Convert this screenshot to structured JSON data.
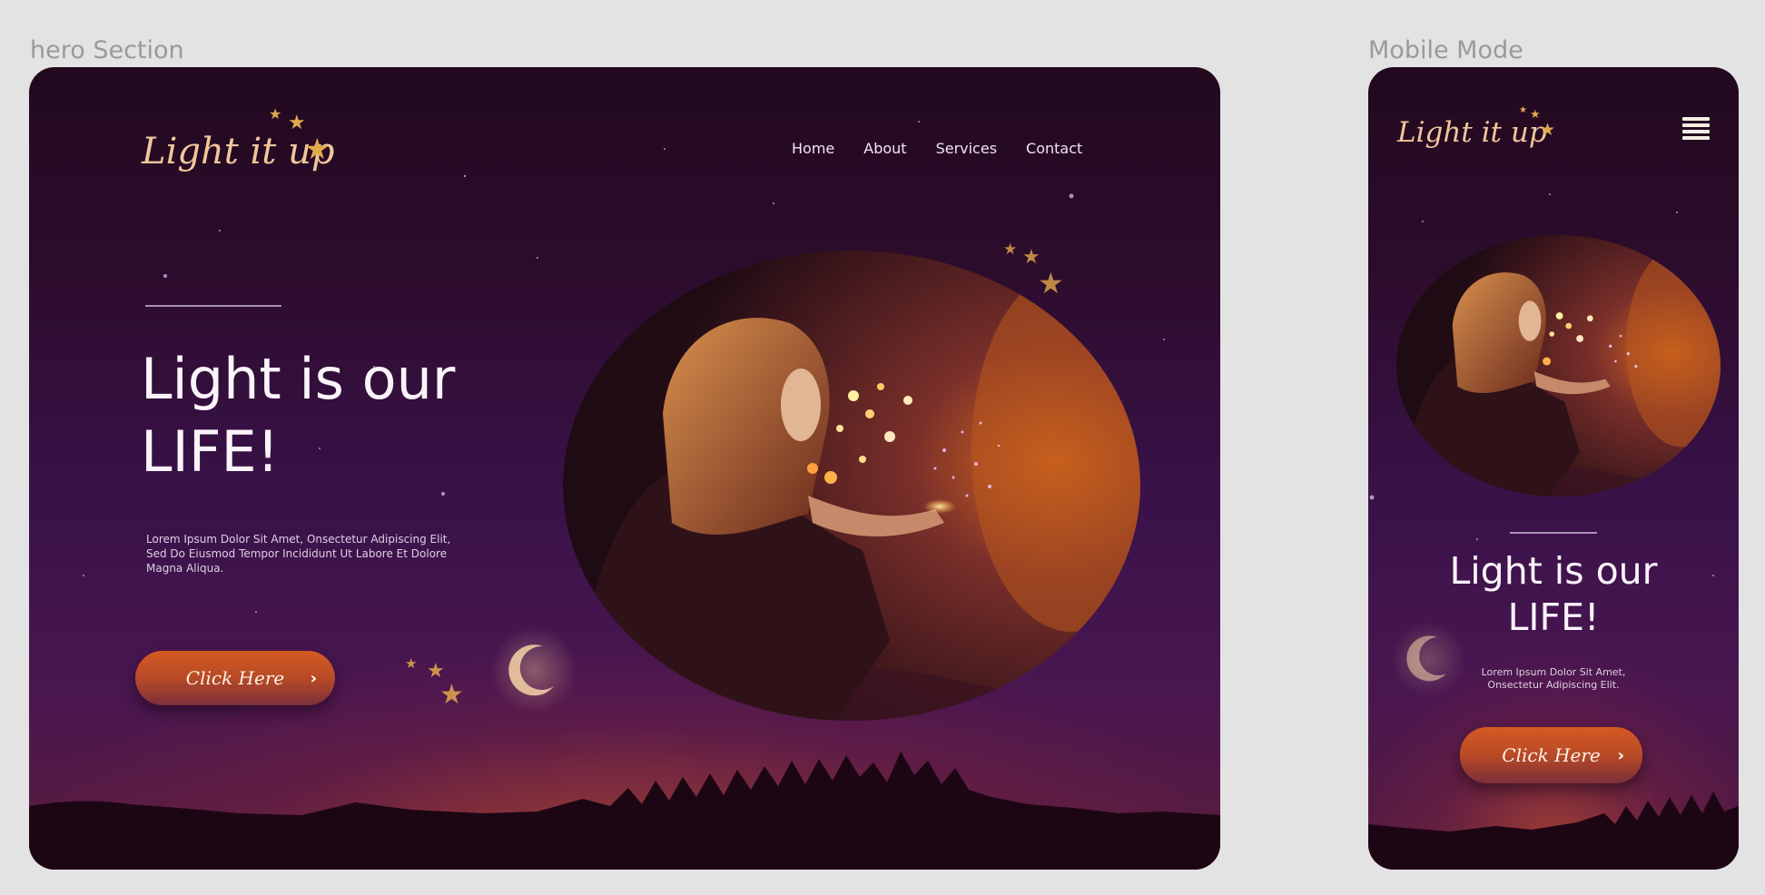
{
  "artboards": {
    "hero_label": "hero Section",
    "mobile_label": "Mobile Mode"
  },
  "brand": {
    "logo_text": "Light it up"
  },
  "nav": {
    "items": [
      "Home",
      "About",
      "Services",
      "Contact"
    ]
  },
  "hero": {
    "headline_line1": "Light is our",
    "headline_line2": "LIFE!",
    "body": "Lorem Ipsum Dolor Sit Amet, Onsectetur Adipiscing Elit, Sed Do Eiusmod Tempor Incididunt Ut Labore Et Dolore Magna Aliqua.",
    "cta_label": "Click Here"
  },
  "mobile": {
    "body": "Lorem Ipsum Dolor Sit Amet, Onsectetur Adipiscing Elit."
  },
  "icons": {
    "star": "star-icon",
    "menu": "hamburger-menu-icon",
    "chevron": "chevron-right-icon",
    "moon": "crescent-moon-icon"
  },
  "colors": {
    "accent_orange": "#d55a22",
    "logo_gold": "#f0c79a",
    "star_gold": "#e2a94c",
    "background_top": "#22091e",
    "background_mid": "#3a124a"
  }
}
